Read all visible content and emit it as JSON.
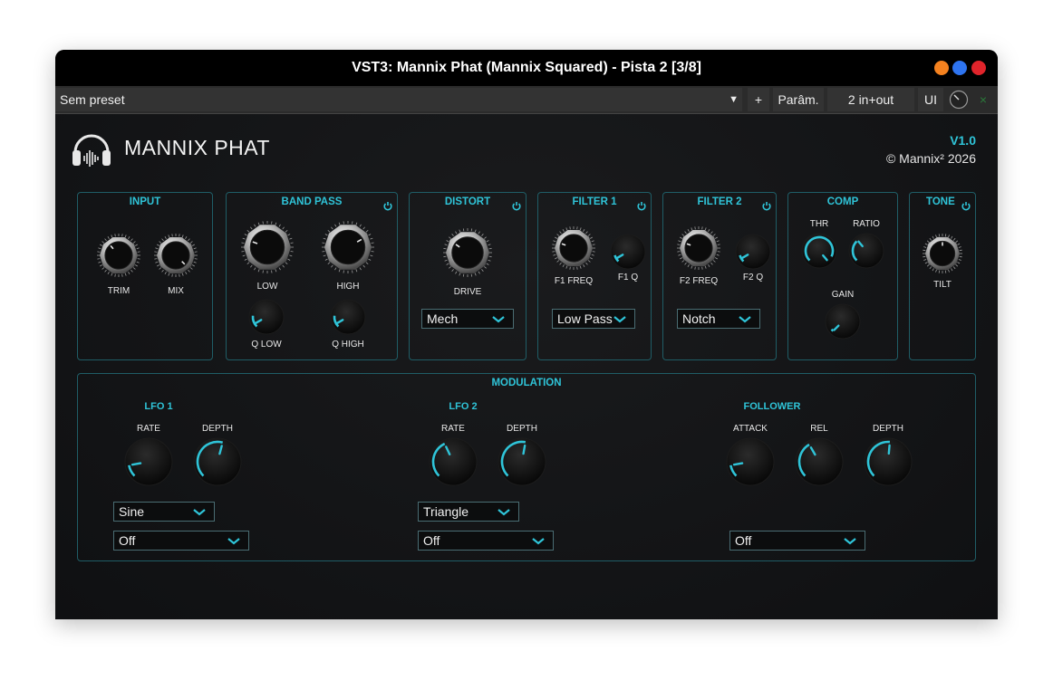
{
  "window": {
    "title": "VST3: Mannix Phat (Mannix Squared) - Pista 2 [3/8]",
    "buttons": {
      "minimize_color": "#f5821f",
      "maximize_color": "#2e74f0",
      "close_color": "#e0242b"
    }
  },
  "toolbar": {
    "preset_value": "Sem preset",
    "dropdown_arrow": "▼",
    "add_label": "+",
    "params_label": "Parâm.",
    "io_label": "2 in+out",
    "ui_label": "UI",
    "close_label": "×"
  },
  "plugin": {
    "name": "MANNIX PHAT",
    "version": "V1.0",
    "copyright": "© Mannix² 2026",
    "accent_color": "#2fc4d8"
  },
  "sections": {
    "input": {
      "title": "INPUT",
      "knobs": [
        "TRIM",
        "MIX"
      ]
    },
    "bandpass": {
      "title": "BAND PASS",
      "knobs": [
        "LOW",
        "HIGH",
        "Q LOW",
        "Q HIGH"
      ]
    },
    "distort": {
      "title": "DISTORT",
      "knobs": [
        "DRIVE"
      ],
      "mode": "Mech"
    },
    "filter1": {
      "title": "FILTER 1",
      "knobs": [
        "F1 FREQ",
        "F1 Q"
      ],
      "type": "Low Pass"
    },
    "filter2": {
      "title": "FILTER 2",
      "knobs": [
        "F2 FREQ",
        "F2 Q"
      ],
      "type": "Notch"
    },
    "comp": {
      "title": "COMP",
      "knobs": [
        "THR",
        "RATIO",
        "GAIN"
      ]
    },
    "tone": {
      "title": "TONE",
      "knobs": [
        "TILT"
      ]
    }
  },
  "modulation": {
    "title": "MODULATION",
    "lfo1": {
      "title": "LFO 1",
      "knobs": [
        "RATE",
        "DEPTH"
      ],
      "shape": "Sine",
      "target": "Off"
    },
    "lfo2": {
      "title": "LFO 2",
      "knobs": [
        "RATE",
        "DEPTH"
      ],
      "shape": "Triangle",
      "target": "Off"
    },
    "follower": {
      "title": "FOLLOWER",
      "knobs": [
        "ATTACK",
        "REL",
        "DEPTH"
      ],
      "target": "Off"
    }
  }
}
